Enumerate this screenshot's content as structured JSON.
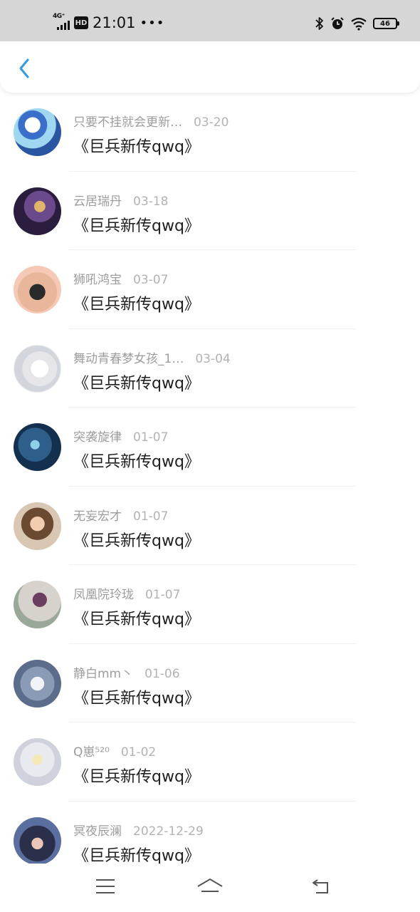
{
  "status_bar": {
    "network_label": "4G⁺",
    "hd_label": "HD",
    "time": "21:01",
    "more_dots": "•••",
    "battery_level": "46",
    "icons": [
      "signal-icon",
      "bluetooth-icon",
      "alarm-icon",
      "wifi-icon",
      "battery-icon"
    ]
  },
  "header": {
    "back_icon": "chevron-left-icon",
    "accent_color": "#2f9be6"
  },
  "colors": {
    "name_text": "#9d9d9d",
    "date_text": "#b3b3b3",
    "title_text": "#1f1f1f"
  },
  "items": [
    {
      "name": "只要不挂就会更新…",
      "date": "03-20",
      "title": "《巨兵新传qwq》"
    },
    {
      "name": "云居瑞丹",
      "date": "03-18",
      "title": "《巨兵新传qwq》"
    },
    {
      "name": "狮吼鸿宝",
      "date": "03-07",
      "title": "《巨兵新传qwq》"
    },
    {
      "name": "舞动青春梦女孩_1…",
      "date": "03-04",
      "title": "《巨兵新传qwq》"
    },
    {
      "name": "突袭旋律",
      "date": "01-07",
      "title": "《巨兵新传qwq》"
    },
    {
      "name": "无妄宏才",
      "date": "01-07",
      "title": "《巨兵新传qwq》"
    },
    {
      "name": "凤凰院玲珑",
      "date": "01-07",
      "title": "《巨兵新传qwq》"
    },
    {
      "name": "静白mm丶",
      "date": "01-06",
      "title": "《巨兵新传qwq》"
    },
    {
      "name": "Q崽⁵²⁰",
      "date": "01-02",
      "title": "《巨兵新传qwq》"
    },
    {
      "name": "冥夜辰澜",
      "date": "2022-12-29",
      "title": "《巨兵新传qwq》"
    }
  ],
  "bottom_nav": {
    "icons": [
      "menu-icon",
      "home-icon",
      "back-icon"
    ]
  }
}
